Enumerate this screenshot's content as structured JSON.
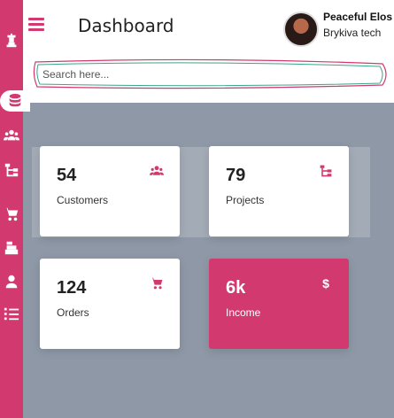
{
  "header": {
    "title": "Dashboard",
    "user": {
      "name": "Peaceful Elos",
      "company": "Brykiva tech"
    }
  },
  "search": {
    "placeholder": "Search here...",
    "value": ""
  },
  "sidebar": {
    "items": [
      {
        "icon": "chess-icon"
      },
      {
        "icon": "database-icon",
        "active": true
      },
      {
        "icon": "users-icon"
      },
      {
        "icon": "sitemap-icon"
      },
      {
        "icon": "cart-icon"
      },
      {
        "icon": "cash-register-icon"
      },
      {
        "icon": "user-tie-icon"
      },
      {
        "icon": "tasks-icon"
      }
    ]
  },
  "cards": [
    {
      "value": "54",
      "label": "Customers",
      "icon": "users-icon"
    },
    {
      "value": "79",
      "label": "Projects",
      "icon": "sitemap-icon"
    },
    {
      "value": "124",
      "label": "Orders",
      "icon": "cart-icon"
    },
    {
      "value": "6k",
      "label": "Income",
      "icon": "dollar-icon",
      "icon_text": "$"
    }
  ],
  "colors": {
    "accent": "#d2396f",
    "background": "#8e98a6"
  }
}
